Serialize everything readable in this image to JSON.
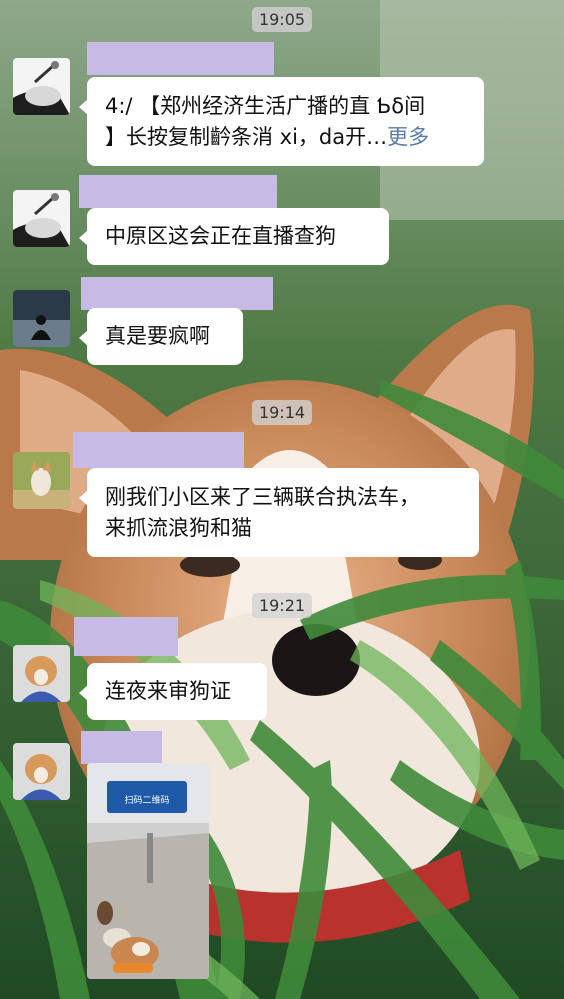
{
  "timestamps": [
    "19:05",
    "19:14",
    "19:21"
  ],
  "messages": [
    {
      "text_line1": "4:/ 【郑州经济生活广播的直 Ƅδ间",
      "text_line2": "】长按复制䶖条消 xi，da开…",
      "more": "更多"
    },
    {
      "text": "中原区这会正在直播查狗"
    },
    {
      "text": "真是要疯啊"
    },
    {
      "text_line1": "刚我们小区来了三辆联合执法车，",
      "text_line2": "来抓流浪狗和猫"
    },
    {
      "text": "连夜来审狗证"
    }
  ],
  "photo_sign": "扫码二维码",
  "colors": {
    "name_placeholder": "#c7bbe6",
    "bubble": "#ffffff",
    "link": "#5a7aa8",
    "timestamp_bg": "#d2d2d2"
  }
}
